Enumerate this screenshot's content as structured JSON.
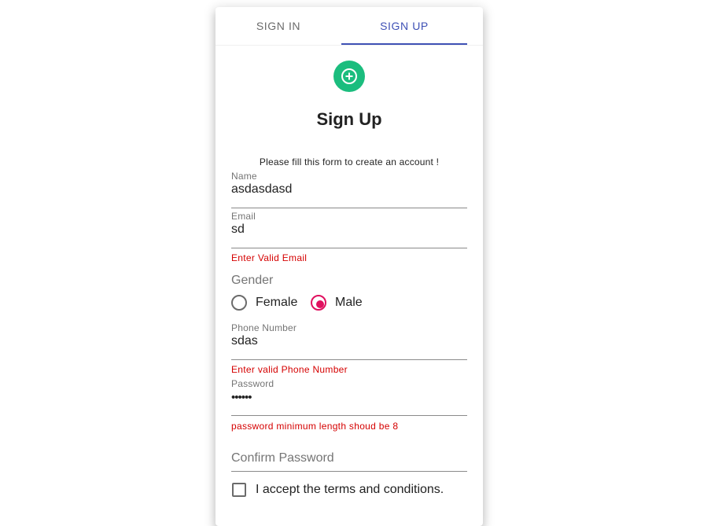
{
  "tabs": {
    "signin": "SIGN IN",
    "signup": "SIGN UP",
    "active": "SIGN UP"
  },
  "colors": {
    "accent": "#3f51b5",
    "avatar": "#1bbd7e",
    "radio_checked": "#e0105f",
    "error": "#d50000"
  },
  "avatar_icon": "add-circle-outline-icon",
  "form": {
    "title": "Sign Up",
    "subtitle": "Please fill this form to create an account !",
    "name": {
      "label": "Name",
      "value": "asdasdasd"
    },
    "email": {
      "label": "Email",
      "value": "sd",
      "error": "Enter Valid Email"
    },
    "gender": {
      "label": "Gender",
      "options": [
        "Female",
        "Male"
      ],
      "selected": "Male"
    },
    "phone": {
      "label": "Phone Number",
      "value": "sdas",
      "error": "Enter valid Phone Number"
    },
    "password": {
      "label": "Password",
      "value": "••••••",
      "error": "password minimum length shoud be 8"
    },
    "confirm_password": {
      "placeholder": "Confirm Password",
      "value": ""
    },
    "terms": {
      "label": "I accept the terms and conditions.",
      "checked": false
    }
  }
}
